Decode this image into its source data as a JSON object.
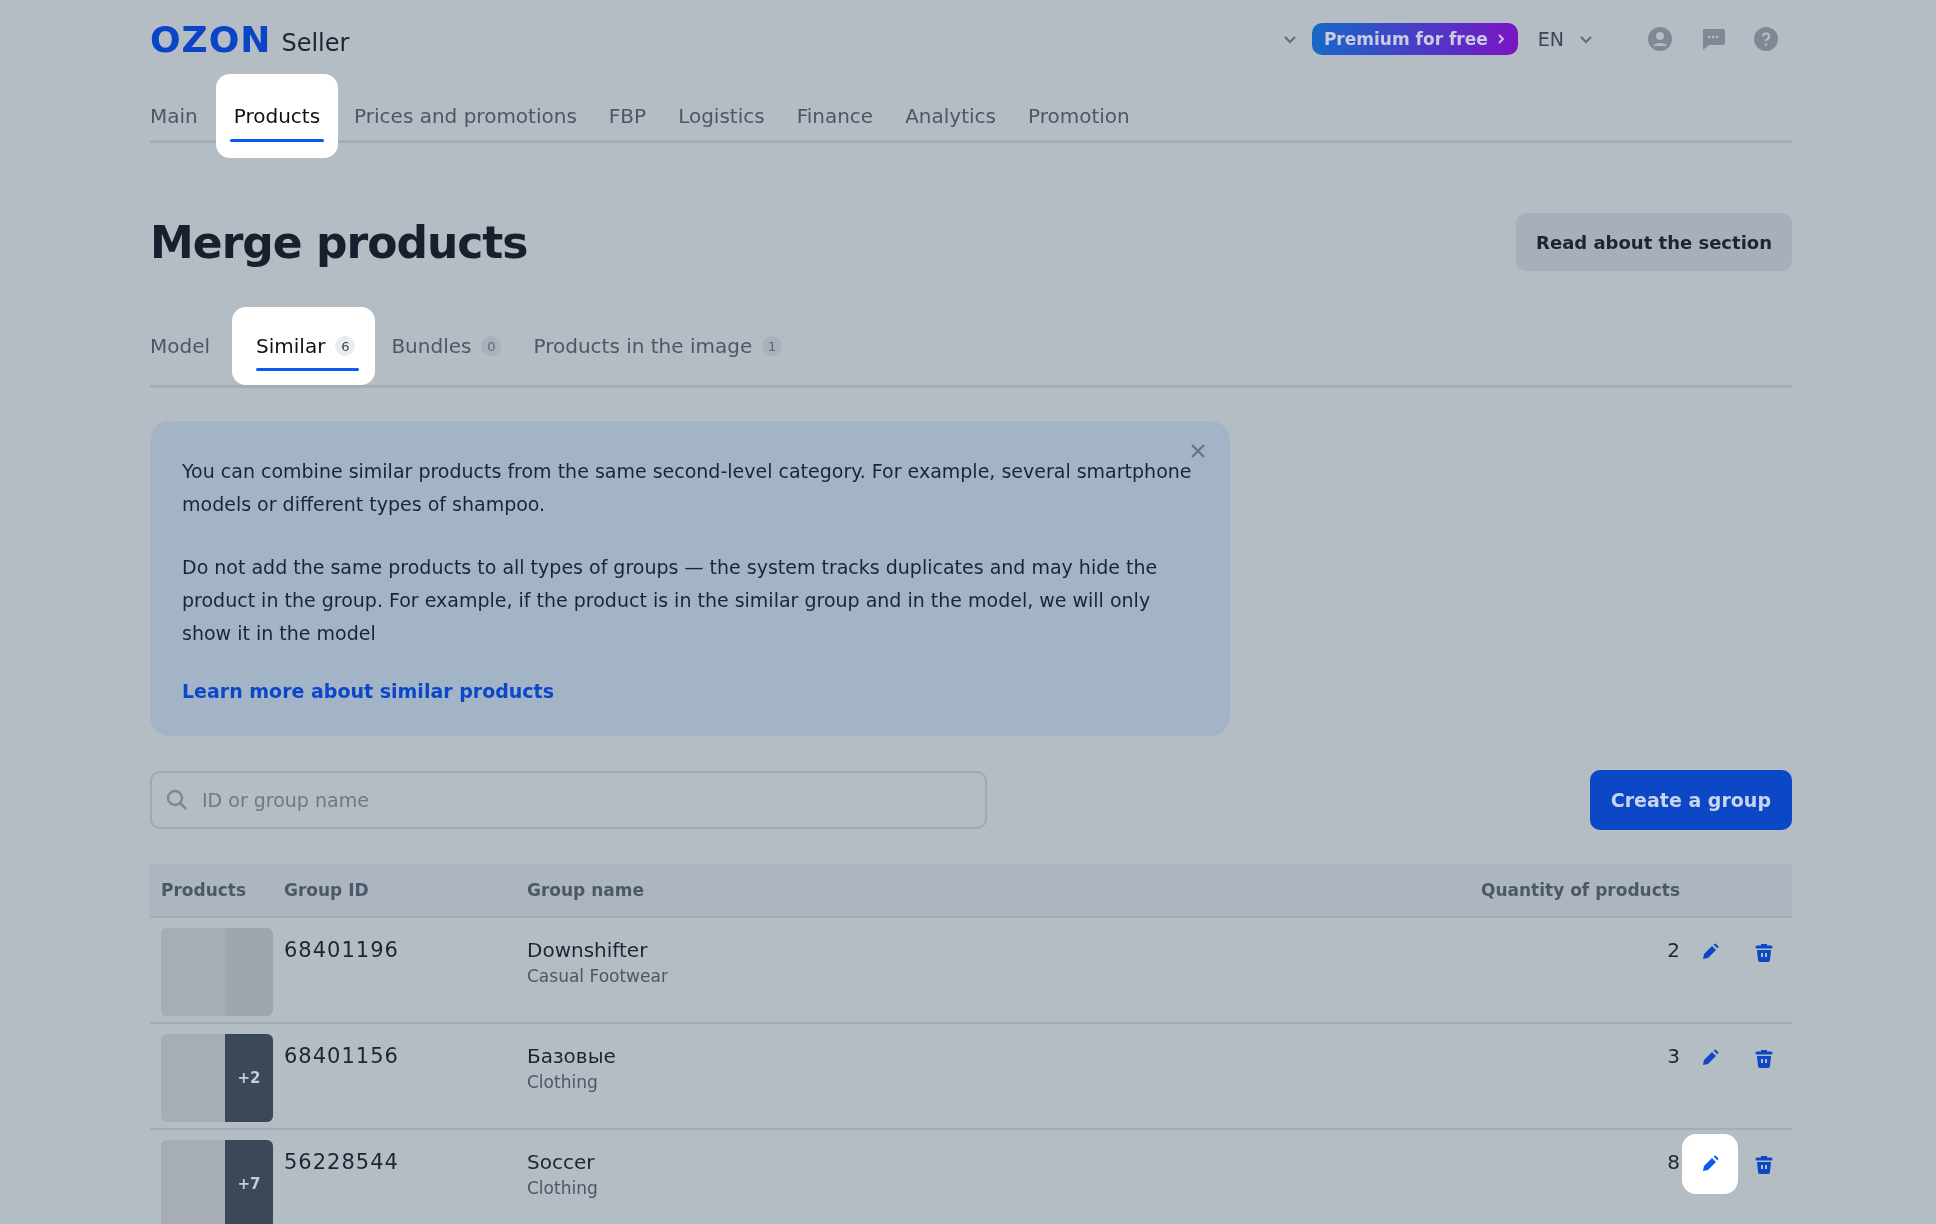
{
  "header": {
    "logo": "OZON",
    "logo_suffix": "Seller",
    "premium": "Premium for free",
    "language": "EN"
  },
  "nav": [
    {
      "label": "Main",
      "selected": false,
      "spotlight": false
    },
    {
      "label": "Products",
      "selected": true,
      "spotlight": true
    },
    {
      "label": "Prices and promotions",
      "selected": false,
      "spotlight": false
    },
    {
      "label": "FBP",
      "selected": false,
      "spotlight": false
    },
    {
      "label": "Logistics",
      "selected": false,
      "spotlight": false
    },
    {
      "label": "Finance",
      "selected": false,
      "spotlight": false
    },
    {
      "label": "Analytics",
      "selected": false,
      "spotlight": false
    },
    {
      "label": "Promotion",
      "selected": false,
      "spotlight": false
    }
  ],
  "page": {
    "title": "Merge products",
    "help_button": "Read about the section"
  },
  "tabs": [
    {
      "label": "Model",
      "selected": false,
      "spotlight": false
    },
    {
      "label": "Similar",
      "count": "6",
      "selected": true,
      "spotlight": true
    },
    {
      "label": "Bundles",
      "count": "0",
      "selected": false,
      "spotlight": false
    },
    {
      "label": "Products in the image",
      "count": "1",
      "selected": false,
      "spotlight": false
    }
  ],
  "banner": {
    "paragraphs": [
      "You can combine similar products from the same second-level category. For example, several smartphone models or different types of shampoo.",
      "Do not add the same products to all types of groups — the system tracks duplicates and may hide the product in the group. For example, if the product is in the similar group and in the model, we will only show it in the model"
    ],
    "link": "Learn more about similar products"
  },
  "search": {
    "placeholder": "ID or group name"
  },
  "create_button": "Create a group",
  "table": {
    "columns": [
      "Products",
      "Group ID",
      "Group name",
      "Quantity of products"
    ],
    "rows": [
      {
        "group_id": "68401196",
        "name": "Downshifter",
        "category": "Casual Footwear",
        "quantity": "2",
        "edit_spotlight": false
      },
      {
        "more": "+2",
        "group_id": "68401156",
        "name": "Базовые",
        "category": "Clothing",
        "quantity": "3",
        "edit_spotlight": false
      },
      {
        "more": "+7",
        "group_id": "56228544",
        "name": "Soccer",
        "category": "Clothing",
        "quantity": "8",
        "edit_spotlight": true
      }
    ]
  }
}
